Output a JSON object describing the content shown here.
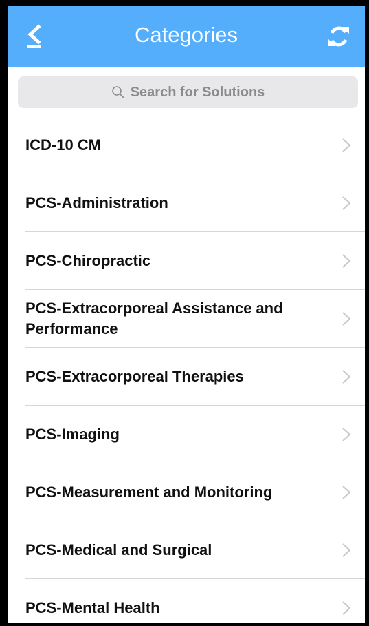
{
  "header": {
    "title": "Categories",
    "back_icon": "back-arrow-icon",
    "refresh_icon": "refresh-icon",
    "background_color": "#55aefb"
  },
  "search": {
    "placeholder": "Search for Solutions",
    "icon": "search-icon"
  },
  "categories": [
    {
      "label": "ICD-10 CM"
    },
    {
      "label": "PCS-Administration"
    },
    {
      "label": "PCS-Chiropractic"
    },
    {
      "label": "PCS-Extracorporeal Assistance and Performance"
    },
    {
      "label": "PCS-Extracorporeal Therapies"
    },
    {
      "label": "PCS-Imaging"
    },
    {
      "label": "PCS-Measurement and Monitoring"
    },
    {
      "label": "PCS-Medical and Surgical"
    },
    {
      "label": "PCS-Mental Health"
    }
  ]
}
